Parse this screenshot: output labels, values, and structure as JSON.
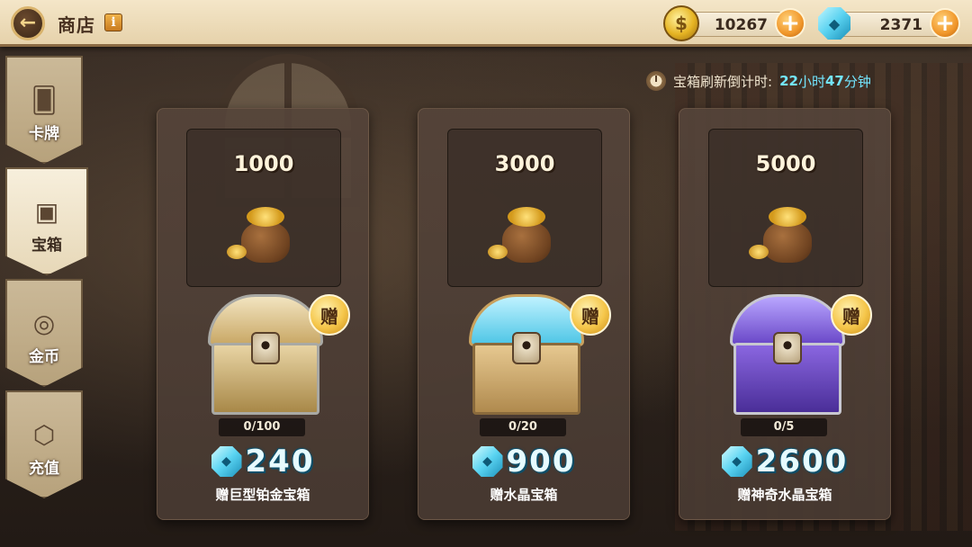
{
  "header": {
    "back_icon": "arrow-left-icon",
    "title": "商店",
    "info_icon": "info-icon",
    "gold": {
      "icon": "gold-coin-icon",
      "value": "10267"
    },
    "gems": {
      "icon": "diamond-gem-icon",
      "value": "2371"
    }
  },
  "sidebar": {
    "items": [
      {
        "label": "卡牌",
        "icon": "cards-icon",
        "active": false
      },
      {
        "label": "宝箱",
        "icon": "chest-icon",
        "active": true
      },
      {
        "label": "金币",
        "icon": "coin-icon",
        "active": false
      },
      {
        "label": "充值",
        "icon": "recharge-gem-icon",
        "active": false
      }
    ]
  },
  "countdown": {
    "icon": "stopwatch-icon",
    "label": "宝箱刷新倒计时:",
    "hours": "22",
    "hours_unit": "小时",
    "minutes": "47",
    "minutes_unit": "分钟"
  },
  "offers": [
    {
      "gold_amount": "1000",
      "gift_badge": "赠",
      "progress": "0/100",
      "price": "240",
      "description": "赠巨型铂金宝箱"
    },
    {
      "gold_amount": "3000",
      "gift_badge": "赠",
      "progress": "0/20",
      "price": "900",
      "description": "赠水晶宝箱"
    },
    {
      "gold_amount": "5000",
      "gift_badge": "赠",
      "progress": "0/5",
      "price": "2600",
      "description": "赠神奇水晶宝箱"
    }
  ],
  "colors": {
    "accent_cyan": "#73e6ff",
    "plus_orange": "#f0962a",
    "card_bg": "#544339"
  }
}
